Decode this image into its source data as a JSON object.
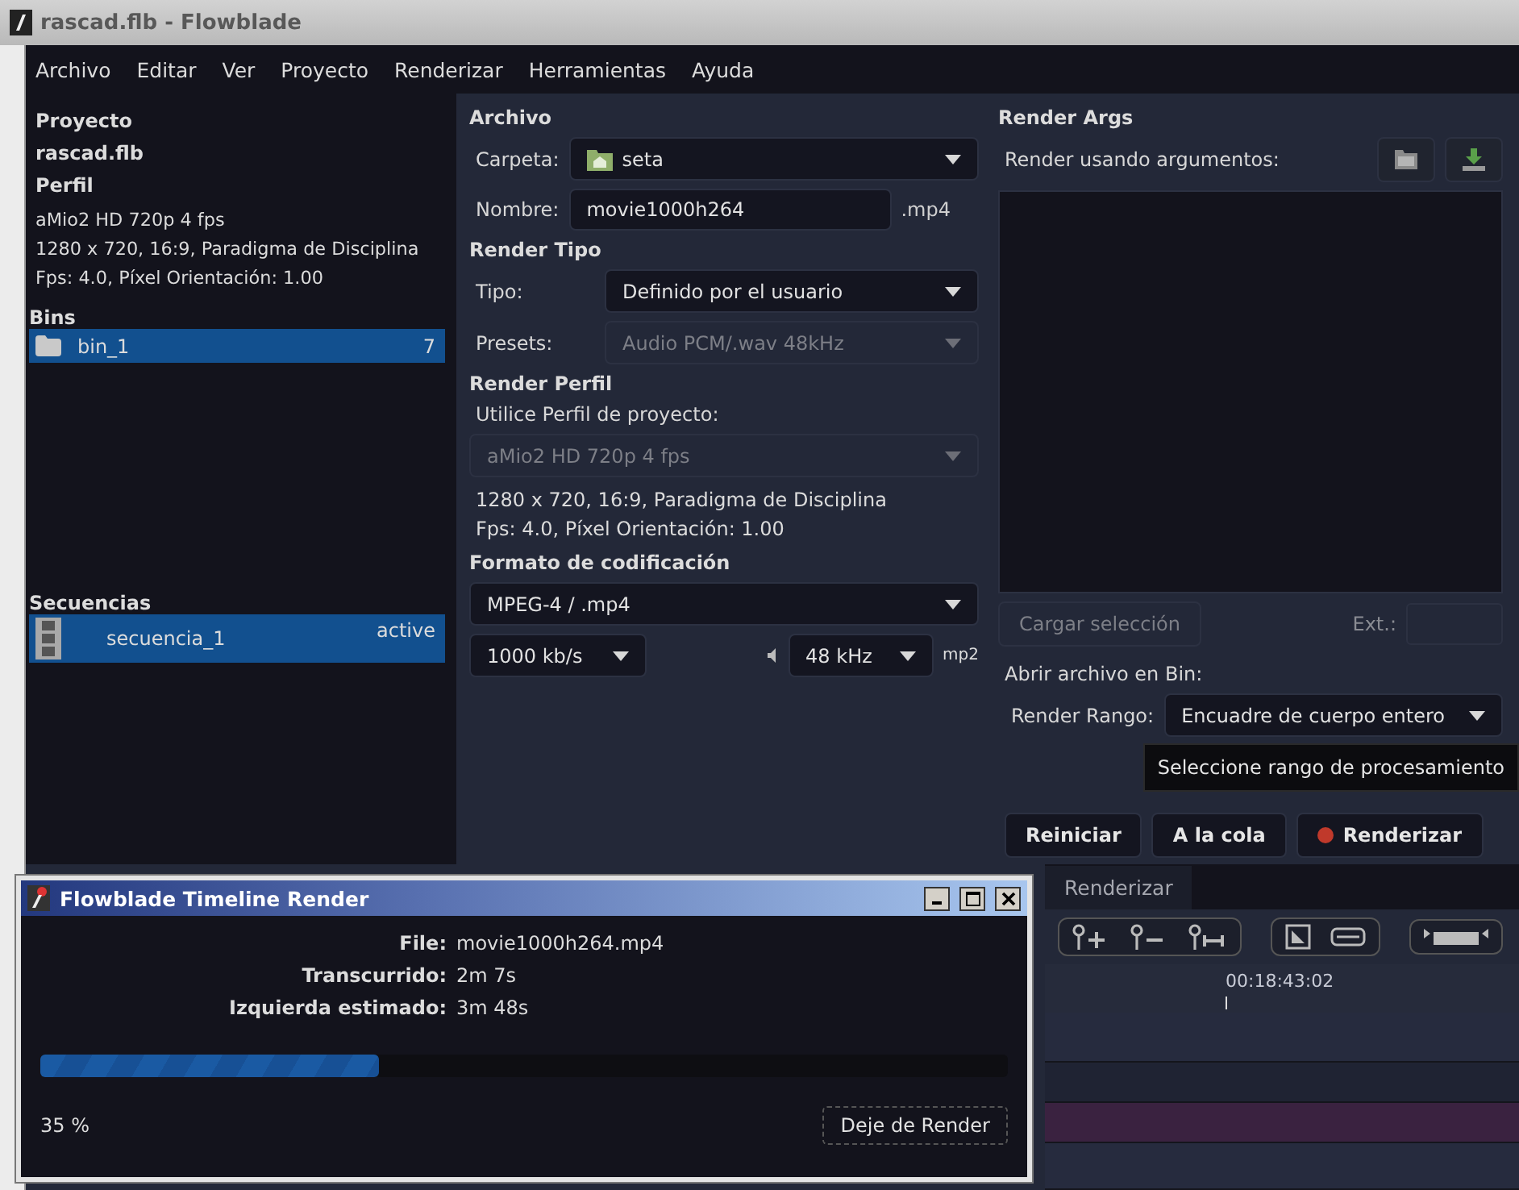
{
  "window": {
    "title": "rascad.flb - Flowblade"
  },
  "menu": [
    "Archivo",
    "Editar",
    "Ver",
    "Proyecto",
    "Renderizar",
    "Herramientas",
    "Ayuda"
  ],
  "project": {
    "heading": "Proyecto",
    "name": "rascad.flb",
    "profile_heading": "Perfil",
    "profile_lines": [
      "aMio2 HD 720p 4 fps",
      "1280 x 720, 16:9, Paradigma de Disciplina",
      "Fps: 4.0, Píxel Orientación: 1.00"
    ]
  },
  "bins": {
    "heading": "Bins",
    "items": [
      {
        "name": "bin_1",
        "count": "7",
        "selected": true
      }
    ]
  },
  "sequences": {
    "heading": "Secuencias",
    "items": [
      {
        "name": "secuencia_1",
        "status": "active",
        "selected": true
      }
    ]
  },
  "file": {
    "heading": "Archivo",
    "folder_label": "Carpeta:",
    "folder": "seta",
    "name_label": "Nombre:",
    "name": "movie1000h264",
    "extension": ".mp4"
  },
  "render_type": {
    "heading": "Render Tipo",
    "type_label": "Tipo:",
    "type": "Definido por el usuario",
    "presets_label": "Presets:",
    "presets": "Audio PCM/.wav 48kHz",
    "presets_disabled": true
  },
  "render_profile": {
    "heading": "Render Perfil",
    "use_project_label": "Utilice Perfil de proyecto:",
    "profile": "aMio2 HD 720p 4 fps",
    "profile_disabled": true,
    "lines": [
      "1280 x 720, 16:9, Paradigma de Disciplina",
      "Fps: 4.0, Píxel Orientación: 1.00"
    ]
  },
  "encoding": {
    "heading": "Formato de codificación",
    "format": "MPEG-4 / .mp4",
    "bitrate": "1000 kb/s",
    "audio_rate": "48 kHz",
    "audio_codec": "mp2"
  },
  "render_args": {
    "heading": "Render Args",
    "label": "Render usando argumentos:",
    "load_button": "Cargar selección",
    "load_disabled": true,
    "ext_label": "Ext.:"
  },
  "open_in_bin": {
    "label": "Abrir archivo en Bin:"
  },
  "range": {
    "label": "Render Rango:",
    "value": "Encuadre de cuerpo entero"
  },
  "tooltip": "Seleccione rango de procesamiento",
  "actions": [
    {
      "label": "Reiniciar",
      "kind": "plain"
    },
    {
      "label": "A la cola",
      "kind": "plain"
    },
    {
      "label": "Renderizar",
      "kind": "record"
    }
  ],
  "bottom_tabs": [
    {
      "label": "Renderizar",
      "selected": false
    }
  ],
  "timecode": "00:18:43:02",
  "dialog": {
    "title": "Flowblade Timeline Render",
    "fields": [
      {
        "label": "File:",
        "value": "movie1000h264.mp4"
      },
      {
        "label": "Transcurrido:",
        "value": "2m 7s"
      },
      {
        "label": "Izquierda estimado:",
        "value": "3m 48s"
      }
    ],
    "progress": {
      "level": 0.35
    },
    "percent": "35 %",
    "stop_button": "Deje de Render"
  }
}
